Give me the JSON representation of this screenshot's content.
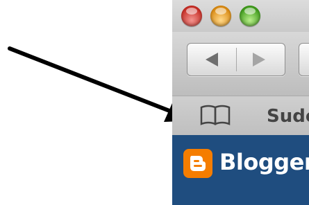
{
  "browser": {
    "window_controls": {
      "close": "red",
      "minimize": "yellow",
      "zoom": "green"
    },
    "bookmarks_bar": {
      "icon": "bookmarks-book-icon",
      "first_item_label": "Sude"
    },
    "page": {
      "brand_name": "Blogger",
      "brand_color": "#f57d00",
      "header_color": "#1f4d7f"
    }
  },
  "annotation": {
    "arrow_color": "#000000",
    "points_to": "bookmarks-book-icon"
  }
}
